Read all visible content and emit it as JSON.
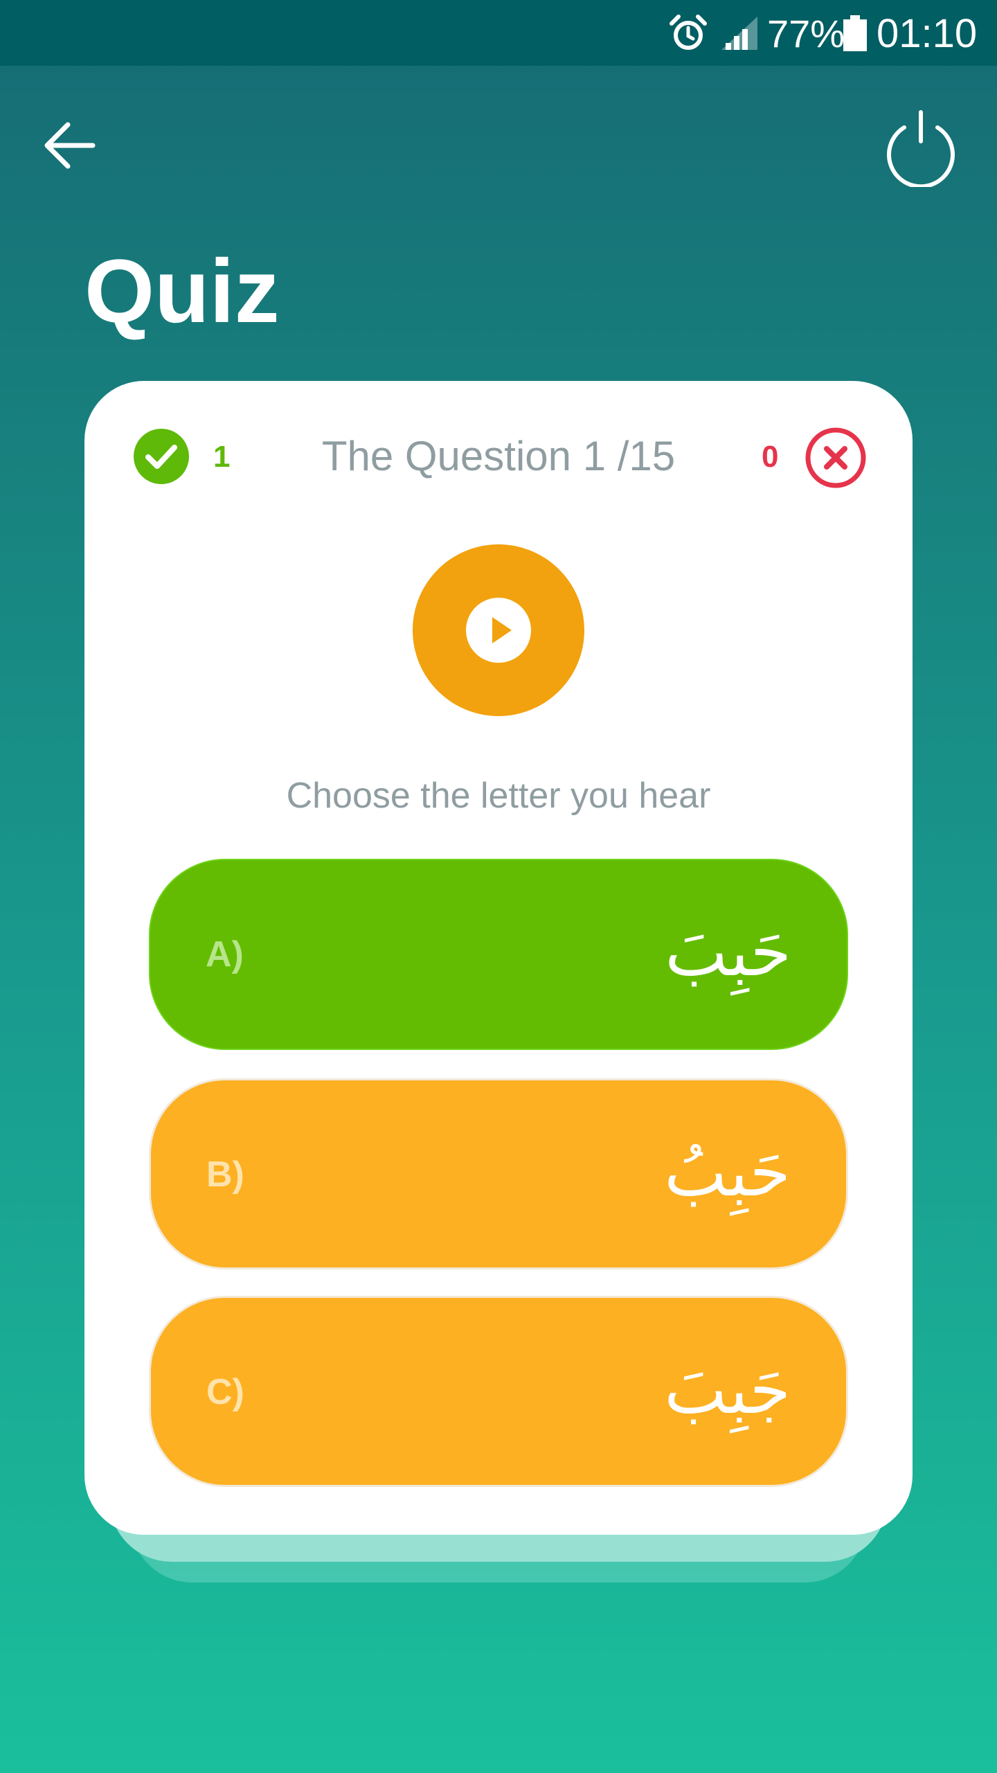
{
  "status_bar": {
    "battery_percent": "77%",
    "time": "01:10",
    "icons": [
      "alarm-icon",
      "signal-icon",
      "battery-icon"
    ]
  },
  "header": {
    "back_icon": "arrow-left-icon",
    "power_icon": "power-icon",
    "title": "Quiz"
  },
  "quiz": {
    "correct_count": "1",
    "question_counter": "The Question 1 /15",
    "wrong_count": "0",
    "instruction": "Choose the letter you hear",
    "play_icon": "play-icon",
    "options": [
      {
        "letter": "A)",
        "text": "حَبِبَ",
        "state": "correct"
      },
      {
        "letter": "B)",
        "text": "حَبِبُ",
        "state": "normal"
      },
      {
        "letter": "C)",
        "text": "جَبِبَ",
        "state": "normal"
      }
    ]
  },
  "colors": {
    "status_bar": "#015e63",
    "gradient_top": "#166b74",
    "gradient_bottom": "#1abf9c",
    "correct": "#63bc01",
    "option": "#fdb022",
    "play": "#f2a20e",
    "wrong": "#e5344b",
    "muted_text": "#8f9da1"
  }
}
